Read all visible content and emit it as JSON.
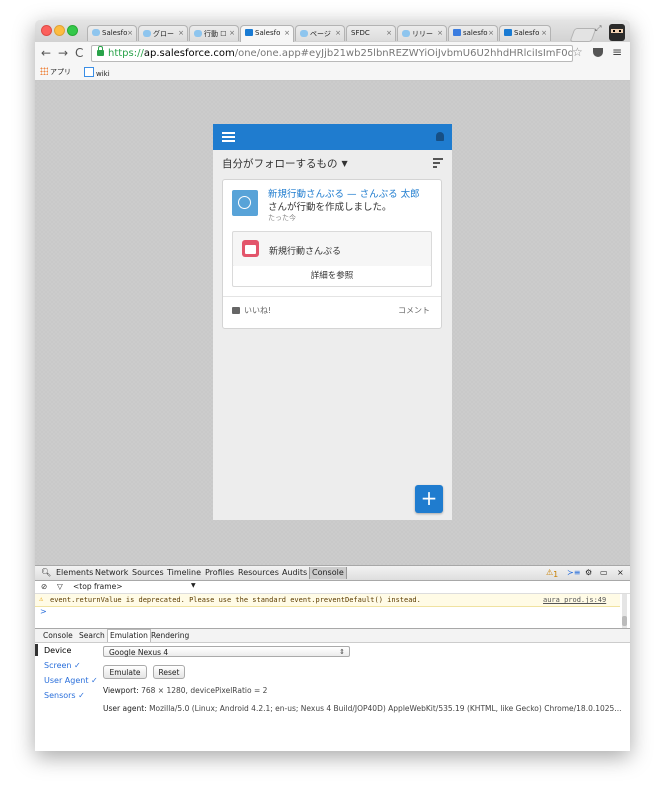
{
  "browser": {
    "tabs": [
      {
        "label": "Salesfo",
        "favicon": "salesforce-cloud-icon"
      },
      {
        "label": "グロー",
        "favicon": "salesforce-cloud-icon"
      },
      {
        "label": "行動 ☐",
        "favicon": "salesforce-cloud-icon"
      },
      {
        "label": "Salesfo",
        "favicon": "salesforce1-icon",
        "active": true
      },
      {
        "label": "ページ",
        "favicon": "salesforce-cloud-icon"
      },
      {
        "label": "SFDC",
        "favicon": "sfdc-icon"
      },
      {
        "label": "リリー",
        "favicon": "salesforce-cloud-icon"
      },
      {
        "label": "salesfo",
        "favicon": "google-icon"
      },
      {
        "label": "Salesfo",
        "favicon": "salesforce-sf-icon"
      }
    ],
    "url": {
      "scheme": "https://",
      "host": "ap.salesforce.com",
      "path": "/one/one.app#eyJjb21wb25lbnREZWYiOiJvbmU6U2hhdHRlciIsImF0dHJpYnV0ZXMi..."
    },
    "bookmarks": [
      {
        "label": "アプリ",
        "icon": "apps-grid-icon"
      },
      {
        "label": "wiki",
        "icon": "wiki-icon"
      }
    ],
    "close_symbol": "×"
  },
  "salesforce": {
    "feed_title": "自分がフォローするもの",
    "post": {
      "actor": "新規行動さんぷる",
      "separator": " — ",
      "target": "さんぷる 太郎",
      "text": "さんが行動を作成しました。",
      "time": "たった今",
      "record_name": "新規行動さんぷる",
      "detail_button": "詳細を参照",
      "like_label": "いいね!",
      "comment_label": "コメント"
    },
    "fab_label": "+",
    "colors": {
      "brand": "#1f7ccf",
      "event_icon": "#e3556b"
    }
  },
  "devtools": {
    "tabs": [
      "Elements",
      "Network",
      "Sources",
      "Timeline",
      "Profiles",
      "Resources",
      "Audits",
      "Console"
    ],
    "active_tab": "Console",
    "warning_count": "1",
    "frame_selector": "<top frame>",
    "console_message": "event.returnValue is deprecated. Please use the standard event.preventDefault() instead.",
    "console_source": "aura_prod.js:49",
    "prompt": ">",
    "drawer_tabs": [
      "Console",
      "Search",
      "Emulation",
      "Rendering"
    ],
    "drawer_active": "Emulation",
    "emulation": {
      "sidebar": [
        "Device",
        "Screen ✓",
        "User Agent ✓",
        "Sensors ✓"
      ],
      "device": "Google Nexus 4",
      "emulate_button": "Emulate",
      "reset_button": "Reset",
      "viewport_label": "Viewport:",
      "viewport_value": "768 × 1280, devicePixelRatio = 2",
      "user_agent_label": "User agent:",
      "user_agent_value": "Mozilla/5.0 (Linux; Android 4.2.1; en-us; Nexus 4 Build/JOP40D) AppleWebKit/535.19 (KHTML, like Gecko) Chrome/18.0.1025..."
    }
  }
}
